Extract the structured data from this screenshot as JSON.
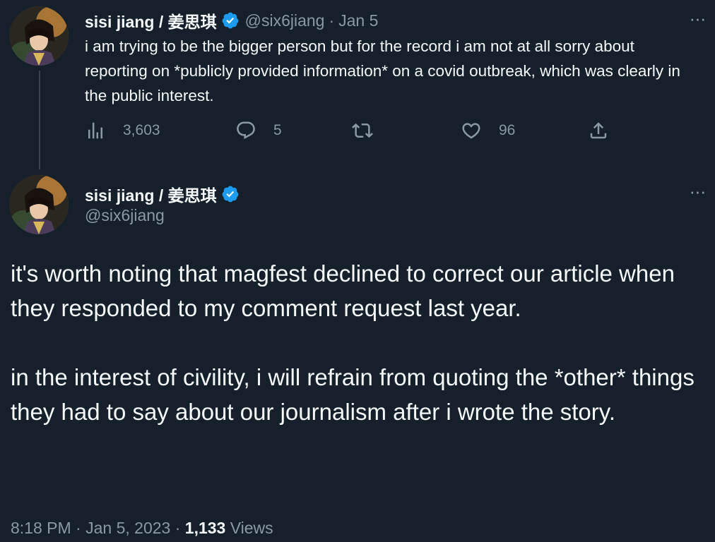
{
  "reply_tweet": {
    "author": {
      "display_name": "sisi jiang / 姜思琪",
      "handle": "@six6jiang"
    },
    "separator": "·",
    "date": "Jan 5",
    "more_label": "···",
    "text": "i am trying to be the bigger person but for the record i am not at all sorry about reporting on *publicly provided information* on a covid outbreak, which was clearly in the public interest.",
    "actions": {
      "views": "3,603",
      "replies": "5",
      "retweets": "",
      "likes": "96"
    }
  },
  "main_tweet": {
    "author": {
      "display_name": "sisi jiang / 姜思琪",
      "handle": "@six6jiang"
    },
    "more_label": "···",
    "paragraphs": [
      "it's worth noting that magfest declined to correct our article when they responded to my comment request last year.",
      "in the interest of civility, i will refrain from quoting the *other* things they had to say about our journalism after i wrote the story."
    ],
    "time": "8:18 PM",
    "date": "Jan 5, 2023",
    "separator": "·",
    "views_count": "1,133",
    "views_label": "Views"
  },
  "colors": {
    "background": "#15202b",
    "text": "#f7f9f9",
    "secondary": "#8b98a5",
    "verified": "#1d9bf0",
    "thread_line": "#38444d"
  },
  "icons": {
    "verified": "verified-badge-icon",
    "views": "bar-chart-icon",
    "reply": "speech-bubble-icon",
    "retweet": "retweet-icon",
    "like": "heart-icon",
    "share": "share-upload-icon",
    "more": "more-horizontal-icon"
  }
}
